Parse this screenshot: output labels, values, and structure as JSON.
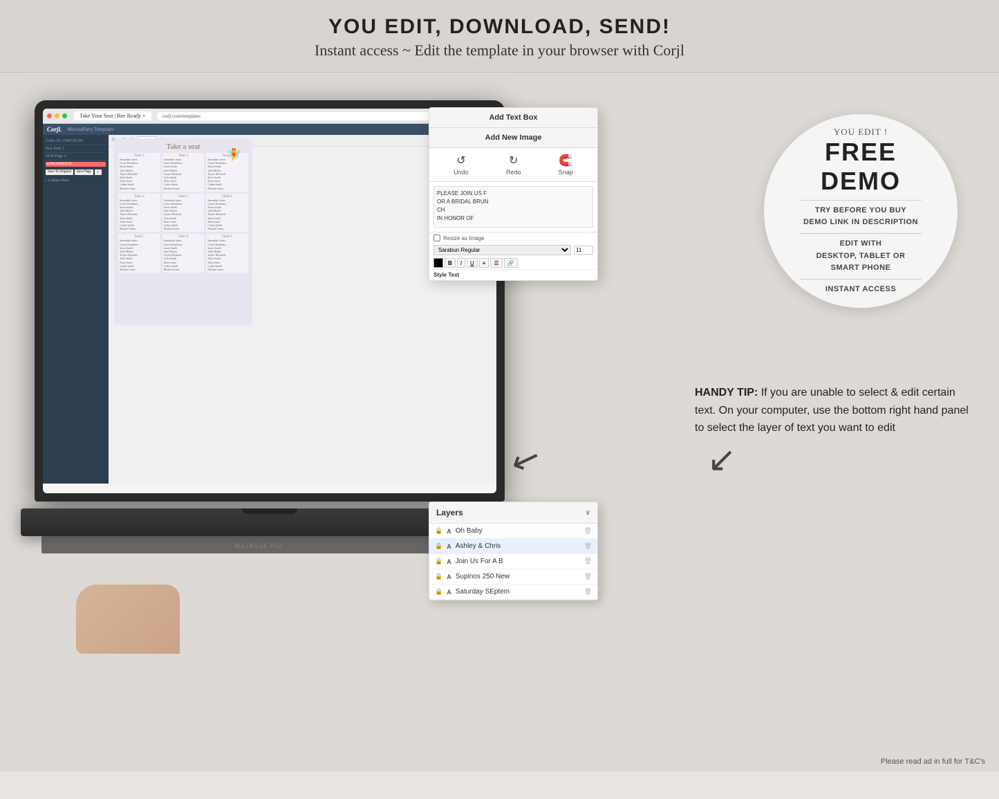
{
  "header": {
    "main_title": "YOU EDIT, DOWNLOAD, SEND!",
    "sub_title": "Instant access ~ Edit the template in your browser with Corjl"
  },
  "demo_circle": {
    "you_edit": "YOU EDIT !",
    "free": "FREE",
    "demo": "DEMO",
    "try_before": "TRY BEFORE YOU BUY",
    "demo_link": "DEMO LINK IN DESCRIPTION",
    "edit_with": "EDIT WITH",
    "devices": "DESKTOP, TABLET OR",
    "smart_phone": "SMART PHONE",
    "instant": "INSTANT ACCESS"
  },
  "corjl_panel": {
    "add_text_box": "Add Text Box",
    "add_new_image": "Add New Image",
    "undo_label": "Undo",
    "redo_label": "Redo",
    "snap_label": "Snap",
    "text_content": "PLEASE JOIN US F\nOR A BRIDAL BRUN\nCH\nIN HONOR OF",
    "resize_as_image": "Resize as Image",
    "font_label": "Sarabun Regular",
    "font_size": "11",
    "style_text": "Style Text"
  },
  "layers_panel": {
    "header": "Layers",
    "items": [
      {
        "lock": "🔒",
        "type": "A",
        "name": "Oh Baby",
        "active": false
      },
      {
        "lock": "🔒",
        "type": "A",
        "name": "Ashley & Chris",
        "active": true
      },
      {
        "lock": "🔒",
        "type": "A",
        "name": "Join Us For A B",
        "active": false
      },
      {
        "lock": "🔒",
        "type": "A",
        "name": "Supinos 250 New",
        "active": false
      },
      {
        "lock": "🔒",
        "type": "A",
        "name": "Saturday SEptem",
        "active": false
      }
    ]
  },
  "handy_tip": {
    "label": "HANDY TIP:",
    "text": " If you are unable to select & edit certain text. On your computer, use the bottom right hand panel to select the layer of text you want to edit"
  },
  "seating_chart": {
    "title": "Take a seat",
    "tables": [
      {
        "title": "Table 1",
        "names": [
          "SAMANTHA JONES",
          "CARRIE BRADSHAW",
          "JASON SMITH",
          "JOHN MITTEN",
          "TAYLOR MICHAELS",
          "TALIA SMITH",
          "DENA JONES",
          "CADEN SMITH",
          "MICHAEL JONES"
        ]
      },
      {
        "title": "Table 2",
        "names": [
          "SAMANTHA JONES",
          "CARRIE BRADSHAW",
          "JASON SMITH",
          "JOHN MITTEN",
          "TAYLOR MICHAELS",
          "TALIA SMITH",
          "DENA JONES",
          "CADEN SMITH",
          "MICHAEL JONES"
        ]
      },
      {
        "title": "Table 3",
        "names": [
          "SAMANTHA JONES",
          "CARRIE BRADSHAW",
          "JASON SMITH",
          "JOHN MITTEN",
          "TAYLOR MICHAELS",
          "TALIA SMITH",
          "DENA JONES",
          "CADEN SMITH",
          "MICHAEL JONES"
        ]
      }
    ]
  },
  "footnote": "Please read ad in full for T&C's"
}
